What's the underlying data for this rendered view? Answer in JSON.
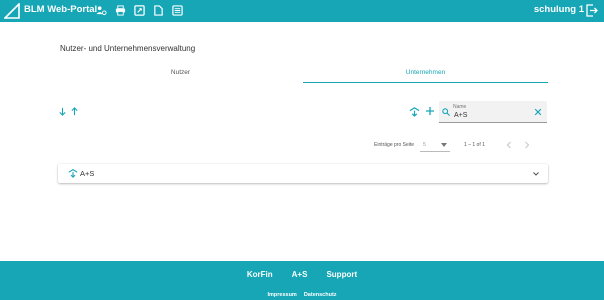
{
  "header": {
    "brand": "BLM Web-Portal",
    "user": "schulung 1",
    "nav_icons": [
      "users-admin-icon",
      "print-icon",
      "dashboard-icon",
      "document-icon",
      "list-icon"
    ]
  },
  "main": {
    "title": "Nutzer- und Unternehmensverwaltung",
    "tabs": [
      {
        "label": "Nutzer",
        "active": false
      },
      {
        "label": "Unternehmen",
        "active": true
      }
    ],
    "search": {
      "label": "Name",
      "value": "A+S"
    },
    "pager": {
      "per_page_label": "Einträge pro Seite",
      "per_page_value": "5",
      "range": "1 – 1 of 1"
    },
    "items": [
      {
        "label": "A+S"
      }
    ]
  },
  "footer": {
    "links": [
      "KorFin",
      "A+S",
      "Support"
    ],
    "small_links": [
      "Impressum",
      "Datenschutz"
    ]
  },
  "colors": {
    "accent": "#16a6b6"
  }
}
